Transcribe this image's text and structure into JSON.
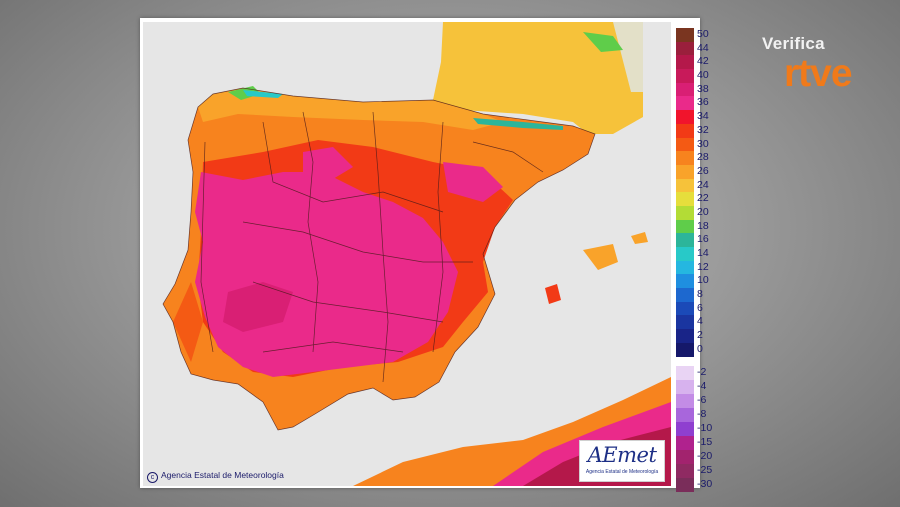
{
  "map": {
    "copyright": "Agencia Estatal de Meteorología",
    "logo": {
      "word": "AEmet",
      "subtitle": "Agencia Estatal de Meteorología"
    },
    "colors": {
      "sea": "#e6e6e6",
      "france": "#f6c23a",
      "africa": "#e9e2c4",
      "hot": "#ea2a8a",
      "warm": "#f23a16",
      "mild": "#f7831e",
      "cool": "#f6c23a",
      "mountain": "#36c9b8"
    }
  },
  "legend": {
    "positive": [
      {
        "label": "50",
        "color": "#7a3520"
      },
      {
        "label": "44",
        "color": "#9a1f3c"
      },
      {
        "label": "42",
        "color": "#b4184a"
      },
      {
        "label": "40",
        "color": "#c81a5a"
      },
      {
        "label": "38",
        "color": "#d91f74"
      },
      {
        "label": "36",
        "color": "#ea2a8a"
      },
      {
        "label": "34",
        "color": "#f1142c"
      },
      {
        "label": "32",
        "color": "#f23a16"
      },
      {
        "label": "30",
        "color": "#f45a14"
      },
      {
        "label": "28",
        "color": "#f7831e"
      },
      {
        "label": "26",
        "color": "#f9a32a"
      },
      {
        "label": "24",
        "color": "#f6c23a"
      },
      {
        "label": "22",
        "color": "#e6de3c"
      },
      {
        "label": "20",
        "color": "#b3dc36"
      },
      {
        "label": "18",
        "color": "#5fcd4a"
      },
      {
        "label": "16",
        "color": "#2cb59a"
      },
      {
        "label": "14",
        "color": "#28c9c8"
      },
      {
        "label": "12",
        "color": "#25b7e0"
      },
      {
        "label": "10",
        "color": "#1f8fe0"
      },
      {
        "label": "8",
        "color": "#1d68cf"
      },
      {
        "label": "6",
        "color": "#1b4ab8"
      },
      {
        "label": "4",
        "color": "#1a35a0"
      },
      {
        "label": "2",
        "color": "#192488"
      },
      {
        "label": "0",
        "color": "#15186a"
      }
    ],
    "negative": [
      {
        "label": "-2",
        "color": "#e9d4f4"
      },
      {
        "label": "-4",
        "color": "#d7b2ee"
      },
      {
        "label": "-6",
        "color": "#c38ce6"
      },
      {
        "label": "-8",
        "color": "#a866dc"
      },
      {
        "label": "-10",
        "color": "#8f3fd0"
      },
      {
        "label": "-15",
        "color": "#b0228e"
      },
      {
        "label": "-20",
        "color": "#a2236e"
      },
      {
        "label": "-25",
        "color": "#8f2a62"
      },
      {
        "label": "-30",
        "color": "#7a2d5a"
      }
    ]
  },
  "brand": {
    "verifica": "Verifica",
    "rtve": "rtve"
  }
}
